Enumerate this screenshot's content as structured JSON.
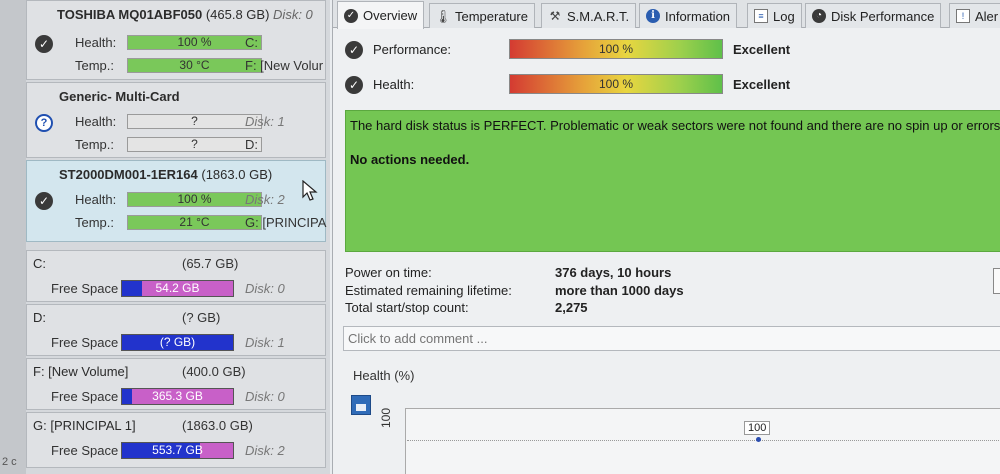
{
  "left_edge": {
    "text": "2 c"
  },
  "disks": [
    {
      "name": "TOSHIBA MQ01ABF050",
      "size": "(465.8 GB)",
      "disk": "Disk: 0",
      "status": "ok",
      "health_label": "Health:",
      "health_value": "100 %",
      "health_pct": 100,
      "temp_label": "Temp.:",
      "temp_value": "30 °C",
      "temp_pct": 100,
      "drive1": "C:",
      "drive2": "F: [New Volur"
    },
    {
      "name": "Generic- Multi-Card",
      "status": "unknown",
      "health_label": "Health:",
      "health_value": "?",
      "health_pct": 0,
      "temp_label": "Temp.:",
      "temp_value": "?",
      "temp_pct": 0,
      "drive1": "Disk: 1",
      "drive2": "D:"
    },
    {
      "name": "ST2000DM001-1ER164",
      "size": "(1863.0 GB)",
      "status": "ok",
      "health_label": "Health:",
      "health_value": "100 %",
      "health_pct": 100,
      "temp_label": "Temp.:",
      "temp_value": "21 °C",
      "temp_pct": 100,
      "drive1": "Disk: 2",
      "drive2": "G: [PRINCIPA"
    }
  ],
  "partitions": [
    {
      "name": "C:",
      "size": "(65.7 GB)",
      "free_label": "Free Space",
      "free_value": "54.2 GB",
      "used_pct": 18,
      "disk": "Disk: 0"
    },
    {
      "name": "D:",
      "size": "(? GB)",
      "free_label": "Free Space",
      "free_value": "(? GB)",
      "used_pct": 100,
      "disk": "Disk: 1"
    },
    {
      "name": "F: [New Volume]",
      "size": "(400.0 GB)",
      "free_label": "Free Space",
      "free_value": "365.3 GB",
      "used_pct": 9,
      "disk": "Disk: 0"
    },
    {
      "name": "G: [PRINCIPAL 1]",
      "size": "(1863.0 GB)",
      "free_label": "Free Space",
      "free_value": "553.7 GB",
      "used_pct": 70,
      "disk": "Disk: 2"
    }
  ],
  "tabs": [
    {
      "label": "Overview",
      "icon": "check-circle-icon",
      "active": true
    },
    {
      "label": "Temperature",
      "icon": "thermometer-icon"
    },
    {
      "label": "S.M.A.R.T.",
      "icon": "tools-icon"
    },
    {
      "label": "Information",
      "icon": "info-icon"
    },
    {
      "label": "Log",
      "icon": "log-icon"
    },
    {
      "label": "Disk Performance",
      "icon": "performance-icon"
    },
    {
      "label": "Aler",
      "icon": "alert-icon"
    }
  ],
  "overview": {
    "performance": {
      "label": "Performance:",
      "value": "100 %",
      "pct": 100,
      "rating": "Excellent"
    },
    "health": {
      "label": "Health:",
      "value": "100 %",
      "pct": 100,
      "rating": "Excellent"
    },
    "status_message": "The hard disk status is PERFECT. Problematic or weak sectors were not found and there are no spin up or errors.",
    "action_message": "No actions needed.",
    "power_on_label": "Power on time:",
    "power_on_value": "376 days, 10 hours",
    "lifetime_label": "Estimated remaining lifetime:",
    "lifetime_value": "more than 1000 days",
    "startstop_label": "Total start/stop count:",
    "startstop_value": "2,275",
    "comment_placeholder": "Click to add comment ...",
    "health_chart_label": "Health (%)"
  },
  "chart_data": {
    "type": "line",
    "title": "Health (%)",
    "series": [
      {
        "values": [
          100
        ]
      }
    ],
    "y_tick_labels": [
      "100"
    ],
    "point_labels": [
      "100"
    ]
  },
  "colors": {
    "status_green": "#74c653",
    "free_space_blue": "#2233cc",
    "used_space_magenta": "#c860c8",
    "health_bar_green": "#7ac85a"
  }
}
